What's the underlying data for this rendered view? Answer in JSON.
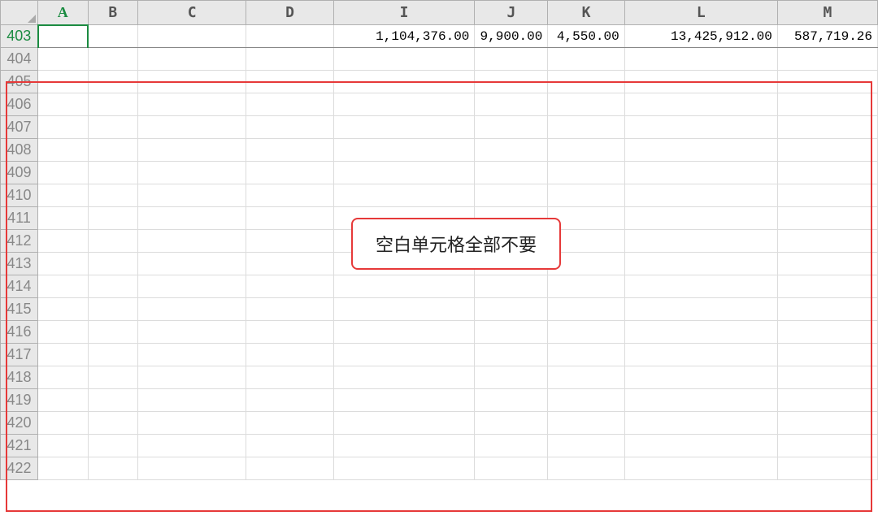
{
  "columns": [
    {
      "label": "A",
      "class": "col-a",
      "active": true
    },
    {
      "label": "B",
      "class": "col-b",
      "active": false
    },
    {
      "label": "C",
      "class": "col-c",
      "active": false
    },
    {
      "label": "D",
      "class": "col-d",
      "active": false
    },
    {
      "label": "I",
      "class": "col-i",
      "active": false
    },
    {
      "label": "J",
      "class": "col-j",
      "active": false
    },
    {
      "label": "K",
      "class": "col-k",
      "active": false
    },
    {
      "label": "L",
      "class": "col-l",
      "active": false
    },
    {
      "label": "M",
      "class": "col-m",
      "active": false
    }
  ],
  "rows": [
    {
      "num": "403",
      "active": true,
      "cells": [
        "",
        "",
        "",
        "",
        "1,104,376.00",
        "9,900.00",
        "4,550.00",
        "13,425,912.00",
        "587,719.26"
      ]
    },
    {
      "num": "404",
      "active": false,
      "cells": [
        "",
        "",
        "",
        "",
        "",
        "",
        "",
        "",
        ""
      ]
    },
    {
      "num": "405",
      "active": false,
      "cells": [
        "",
        "",
        "",
        "",
        "",
        "",
        "",
        "",
        ""
      ]
    },
    {
      "num": "406",
      "active": false,
      "cells": [
        "",
        "",
        "",
        "",
        "",
        "",
        "",
        "",
        ""
      ]
    },
    {
      "num": "407",
      "active": false,
      "cells": [
        "",
        "",
        "",
        "",
        "",
        "",
        "",
        "",
        ""
      ]
    },
    {
      "num": "408",
      "active": false,
      "cells": [
        "",
        "",
        "",
        "",
        "",
        "",
        "",
        "",
        ""
      ]
    },
    {
      "num": "409",
      "active": false,
      "cells": [
        "",
        "",
        "",
        "",
        "",
        "",
        "",
        "",
        ""
      ]
    },
    {
      "num": "410",
      "active": false,
      "cells": [
        "",
        "",
        "",
        "",
        "",
        "",
        "",
        "",
        ""
      ]
    },
    {
      "num": "411",
      "active": false,
      "cells": [
        "",
        "",
        "",
        "",
        "",
        "",
        "",
        "",
        ""
      ]
    },
    {
      "num": "412",
      "active": false,
      "cells": [
        "",
        "",
        "",
        "",
        "",
        "",
        "",
        "",
        ""
      ]
    },
    {
      "num": "413",
      "active": false,
      "cells": [
        "",
        "",
        "",
        "",
        "",
        "",
        "",
        "",
        ""
      ]
    },
    {
      "num": "414",
      "active": false,
      "cells": [
        "",
        "",
        "",
        "",
        "",
        "",
        "",
        "",
        ""
      ]
    },
    {
      "num": "415",
      "active": false,
      "cells": [
        "",
        "",
        "",
        "",
        "",
        "",
        "",
        "",
        ""
      ]
    },
    {
      "num": "416",
      "active": false,
      "cells": [
        "",
        "",
        "",
        "",
        "",
        "",
        "",
        "",
        ""
      ]
    },
    {
      "num": "417",
      "active": false,
      "cells": [
        "",
        "",
        "",
        "",
        "",
        "",
        "",
        "",
        ""
      ]
    },
    {
      "num": "418",
      "active": false,
      "cells": [
        "",
        "",
        "",
        "",
        "",
        "",
        "",
        "",
        ""
      ]
    },
    {
      "num": "419",
      "active": false,
      "cells": [
        "",
        "",
        "",
        "",
        "",
        "",
        "",
        "",
        ""
      ]
    },
    {
      "num": "420",
      "active": false,
      "cells": [
        "",
        "",
        "",
        "",
        "",
        "",
        "",
        "",
        ""
      ]
    },
    {
      "num": "421",
      "active": false,
      "cells": [
        "",
        "",
        "",
        "",
        "",
        "",
        "",
        "",
        ""
      ]
    },
    {
      "num": "422",
      "active": false,
      "cells": [
        "",
        "",
        "",
        "",
        "",
        "",
        "",
        "",
        ""
      ]
    }
  ],
  "callout_text": "空白单元格全部不要"
}
